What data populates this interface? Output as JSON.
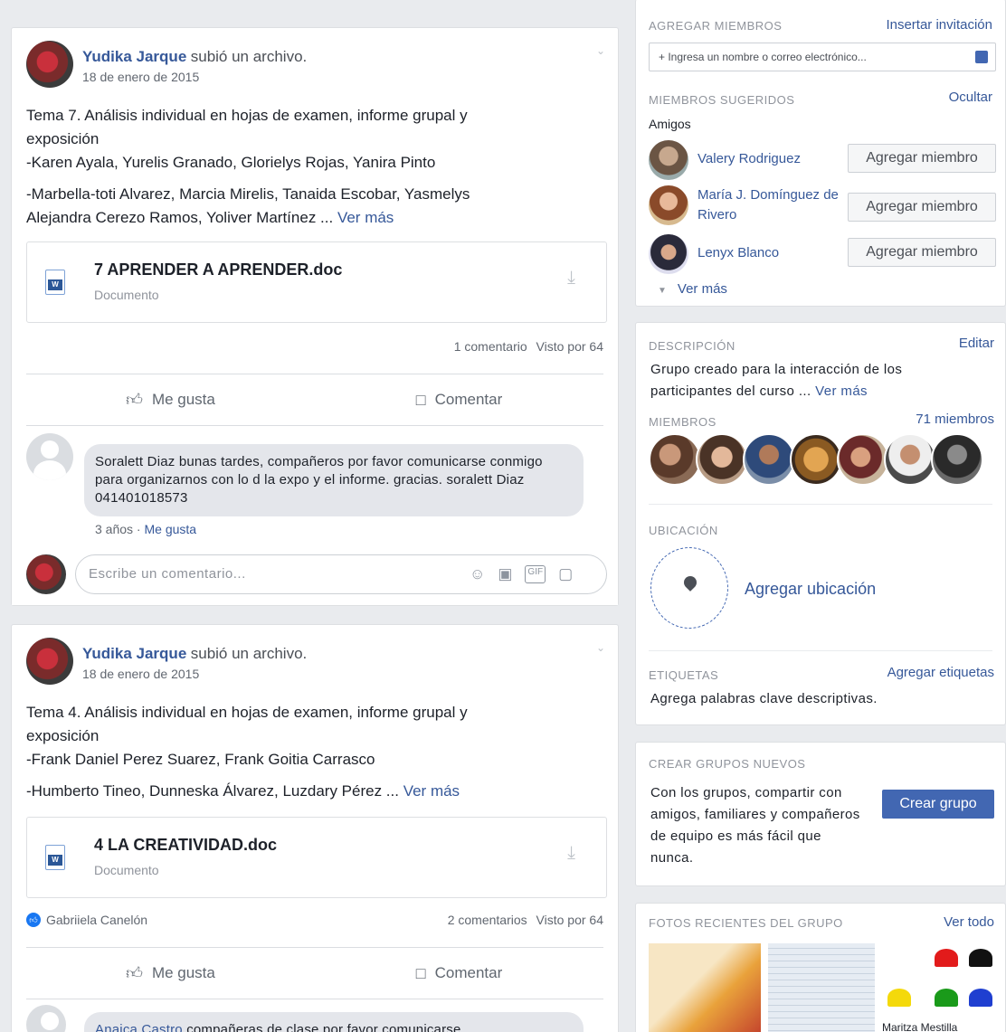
{
  "posts": [
    {
      "author": "Yudika Jarque",
      "action": "subió un archivo.",
      "date": "18 de enero de 2015",
      "lines": [
        "Tema 7. Análisis individual en hojas de examen, informe grupal y",
        "exposición",
        "-Karen Ayala, Yurelis Granado, Glorielys Rojas, Yanira Pinto"
      ],
      "line_extra_1": "-Marbella-toti Alvarez, Marcia Mirelis, Tanaida Escobar, Yasmelys",
      "line_extra_2": "Alejandra Cerezo Ramos, Yoliver Martínez ...",
      "see_more": "Ver más",
      "file_name": "7 APRENDER A APRENDER.doc",
      "file_type": "Documento",
      "comments_count": "1 comentario",
      "seen_by": "Visto por 64",
      "like_label": "Me gusta",
      "comment_label": "Comentar",
      "comment": {
        "text": "Soralett Diaz bunas tardes, compañeros por favor comunicarse conmigo para organizarnos con lo d la expo y el informe. gracias. soralett Diaz 041401018573",
        "time": "3 años",
        "like": "Me gusta"
      },
      "reply_placeholder": "Escribe un comentario..."
    },
    {
      "author": "Yudika Jarque",
      "action": "subió un archivo.",
      "date": "18 de enero de 2015",
      "lines": [
        "Tema 4. Análisis individual en hojas de examen, informe grupal y",
        "exposición",
        "-Frank Daniel Perez Suarez, Frank Goitia Carrasco"
      ],
      "line_extra_1": "-Humberto Tineo, Dunneska Álvarez, Luzdary Pérez ...",
      "see_more": "Ver más",
      "file_name": "4 LA CREATIVIDAD.doc",
      "file_type": "Documento",
      "reaction_name": "Gabriiela Canelón",
      "comments_count": "2 comentarios",
      "seen_by": "Visto por 64",
      "like_label": "Me gusta",
      "comment_label": "Comentar",
      "comment_partial_author": "Anaica Castro",
      "comment_partial_text": "compañeras de clase por favor comunicarse"
    }
  ],
  "sidebar": {
    "add_members": {
      "title": "AGREGAR MIEMBROS",
      "invite_link": "Insertar invitación",
      "input_placeholder": "+ Ingresa un nombre o correo electrónico..."
    },
    "suggested": {
      "title": "MIEMBROS SUGERIDOS",
      "hide": "Ocultar",
      "friends_label": "Amigos",
      "people": [
        {
          "name": "Valery Rodriguez",
          "button": "Agregar miembro"
        },
        {
          "name": "María J. Domínguez de Rivero",
          "button": "Agregar miembro"
        },
        {
          "name": "Lenyx Blanco",
          "button": "Agregar miembro"
        }
      ],
      "see_more": "Ver más"
    },
    "description": {
      "title": "DESCRIPCIÓN",
      "edit": "Editar",
      "text": "Grupo creado para la interacción de los participantes del curso ...",
      "see_more": "Ver más"
    },
    "members": {
      "title": "MIEMBROS",
      "count": "71 miembros"
    },
    "location": {
      "title": "UBICACIÓN",
      "add": "Agregar ubicación"
    },
    "tags": {
      "title": "ETIQUETAS",
      "add": "Agregar etiquetas",
      "hint": "Agrega palabras clave descriptivas."
    },
    "create_groups": {
      "title": "CREAR GRUPOS NUEVOS",
      "text": "Con los grupos, compartir con amigos, familiares y compañeros de equipo es más fácil que nunca.",
      "button": "Crear grupo"
    },
    "photos": {
      "title": "FOTOS RECIENTES DEL GRUPO",
      "see_all": "Ver todo",
      "caption": "Maritza Mestilla"
    }
  }
}
